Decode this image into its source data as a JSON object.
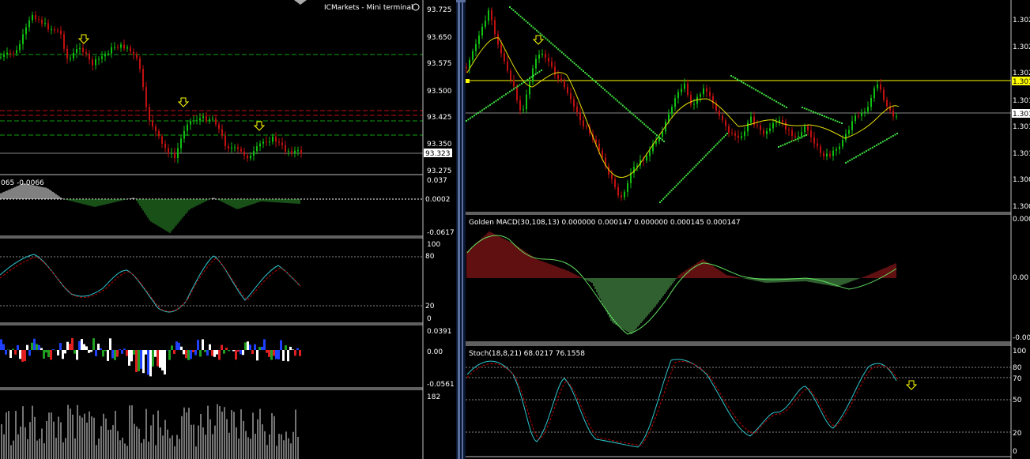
{
  "terminal_title": "ICMarkets - Mini terminal",
  "colors": {
    "background": "#000000",
    "bullish_candle": "#10c010",
    "bearish_candle": "#c01010",
    "green_line": "#00c000",
    "red_line": "#c00000",
    "yellow_line": "#ffff00",
    "cyan_line": "#2ec8d0",
    "divider": "#c0c0c0",
    "splitter": "#5a6f9e"
  },
  "left_chart": {
    "price_axis": [
      "93.725",
      "93.650",
      "93.575",
      "93.500",
      "93.425",
      "93.350",
      "93.275"
    ],
    "current_price": "93.323",
    "indicator1": {
      "label": "065 -0.0066",
      "axis": [
        "0.037",
        "0.0002",
        "-0.0617"
      ]
    },
    "indicator2": {
      "axis": [
        "100",
        "80",
        "20",
        "0"
      ]
    },
    "indicator3": {
      "axis": [
        "0.0391",
        "0.00",
        "-0.0561"
      ]
    },
    "indicator4": {
      "axis": [
        "182"
      ]
    }
  },
  "right_chart": {
    "price_axis": [
      "1.302",
      "1.302",
      "1.302",
      "1.301",
      "1.301",
      "1.301",
      "1.300",
      "1.300",
      "1.300"
    ],
    "yellow_level_tag": "1.301",
    "current_price": "1.301",
    "macd": {
      "label": "Golden MACD(30,108,13) 0.000000 0.000147 0.000000 0.000145 0.000147",
      "axis": [
        "0.000",
        "0.00",
        "-0.000"
      ]
    },
    "stoch": {
      "label": "Stoch(18,8,21) 68.0217 76.1558",
      "axis": [
        "100",
        "80",
        "70",
        "50",
        "20",
        "0"
      ]
    }
  }
}
